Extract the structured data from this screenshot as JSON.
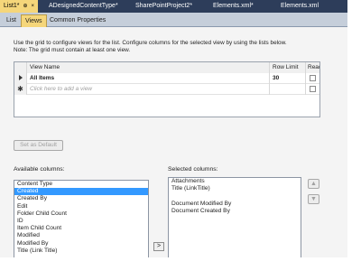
{
  "doc_tabs": [
    {
      "label": "List1*",
      "active": true
    },
    {
      "label": "ADesignedContentType*",
      "active": false
    },
    {
      "label": "SharePointProject2*",
      "active": false
    },
    {
      "label": "Elements.xml*",
      "active": false
    },
    {
      "label": "Elements.xml",
      "active": false
    }
  ],
  "pin_glyph": "⊕",
  "close_glyph": "×",
  "designer_tabs": [
    {
      "label": "List",
      "active": false
    },
    {
      "label": "Views",
      "active": true
    },
    {
      "label": "Common Properties",
      "active": false
    }
  ],
  "description": {
    "line1": "Use the grid to configure views for the list. Configure columns for the selected view by using the lists below.",
    "line2": "Note: The grid must contain at least one view."
  },
  "grid": {
    "headers": {
      "name": "View Name",
      "limit": "Row Limit",
      "readonly": "Read Only"
    },
    "rows": [
      {
        "name": "All Items",
        "limit": "30",
        "readonly": false,
        "current": true
      }
    ],
    "new_row_placeholder": "Click here to add a view",
    "new_row_glyph": "✱"
  },
  "set_default_label": "Set as Default",
  "available": {
    "label": "Available columns:",
    "items": [
      "Content Type",
      "Created",
      "Created By",
      "Edit",
      "Folder Child Count",
      "ID",
      "Item Child Count",
      "Modified",
      "Modified By",
      "Title (Link Title)"
    ],
    "selected_index": 1
  },
  "selected": {
    "label": "Selected columns:",
    "items": [
      "Attachments",
      "Title (LinkTitle)",
      "",
      "Document Modified By",
      "Document Created By"
    ]
  },
  "buttons": {
    "move_right": ">",
    "move_up": "▲",
    "move_down": "▼"
  }
}
